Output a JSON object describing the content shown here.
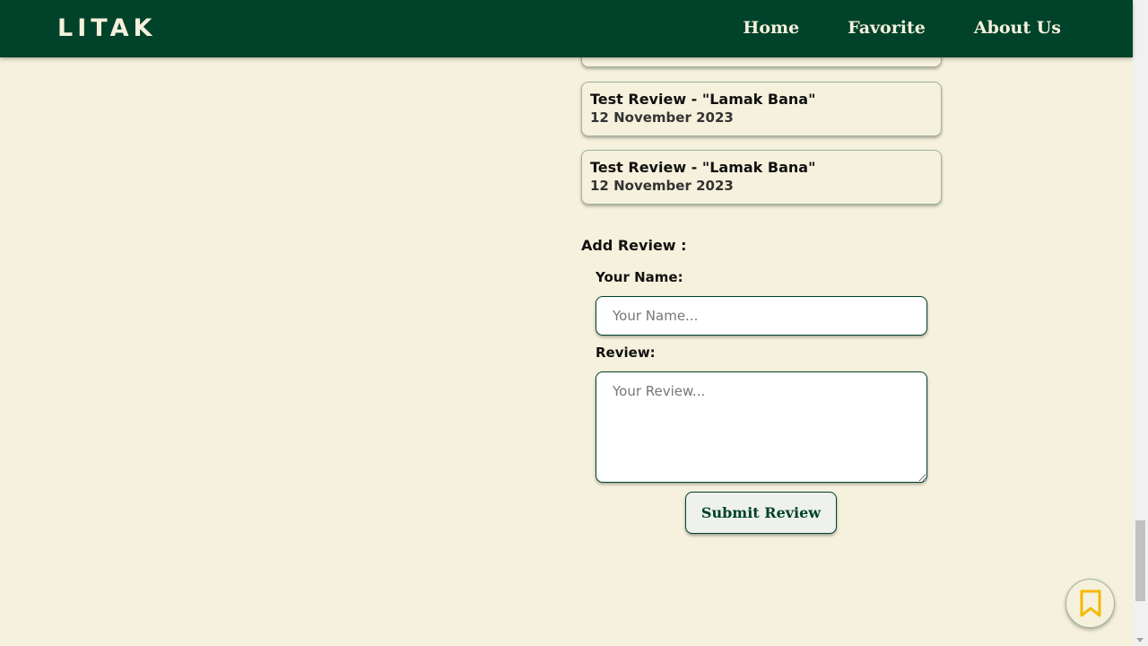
{
  "header": {
    "brand": "LITAK",
    "nav": [
      "Home",
      "Favorite",
      "About Us"
    ]
  },
  "reviews": [
    {
      "title": "Test Review - \"Lamak Bana\"",
      "date": "12 November 2023"
    },
    {
      "title": "Test Review - \"Lamak Bana\"",
      "date": "12 November 2023"
    }
  ],
  "form": {
    "section_title": "Add Review :",
    "name_label": "Your Name:",
    "name_placeholder": "Your Name...",
    "review_label": "Review:",
    "review_placeholder": "Your Review...",
    "submit_label": "Submit Review"
  },
  "icons": {
    "fab": "bookmark-icon"
  },
  "colors": {
    "primary": "#00422a",
    "background": "#f5f1dc",
    "accent": "#f5b800"
  }
}
